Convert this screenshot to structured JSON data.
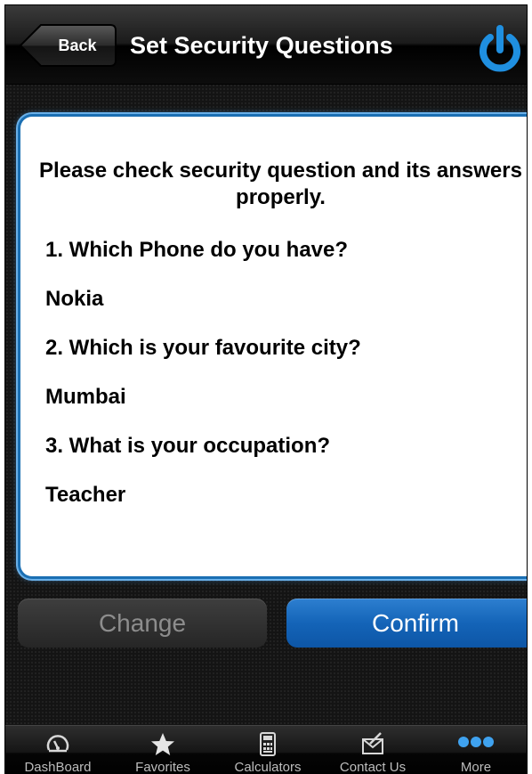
{
  "nav": {
    "back_label": "Back",
    "title": "Set Security Questions",
    "power_icon": "power-icon"
  },
  "panel": {
    "instruction": "Please check security question and its answers properly.",
    "questions": [
      {
        "question": "1. Which Phone do you have?",
        "answer": "Nokia"
      },
      {
        "question": "2. Which is your favourite city?",
        "answer": "Mumbai"
      },
      {
        "question": "3. What is your occupation?",
        "answer": "Teacher"
      }
    ]
  },
  "actions": {
    "change_label": "Change",
    "confirm_label": "Confirm"
  },
  "tabbar": {
    "items": [
      {
        "label": "DashBoard",
        "icon": "dashboard-gauge-icon"
      },
      {
        "label": "Favorites",
        "icon": "star-icon"
      },
      {
        "label": "Calculators",
        "icon": "calculator-icon"
      },
      {
        "label": "Contact Us",
        "icon": "contact-envelope-icon"
      },
      {
        "label": "More",
        "icon": "more-dots-icon"
      }
    ]
  },
  "colors": {
    "accent_blue": "#1464b8",
    "power_blue": "#1f8fe0",
    "panel_border": "#1b6fb3"
  }
}
